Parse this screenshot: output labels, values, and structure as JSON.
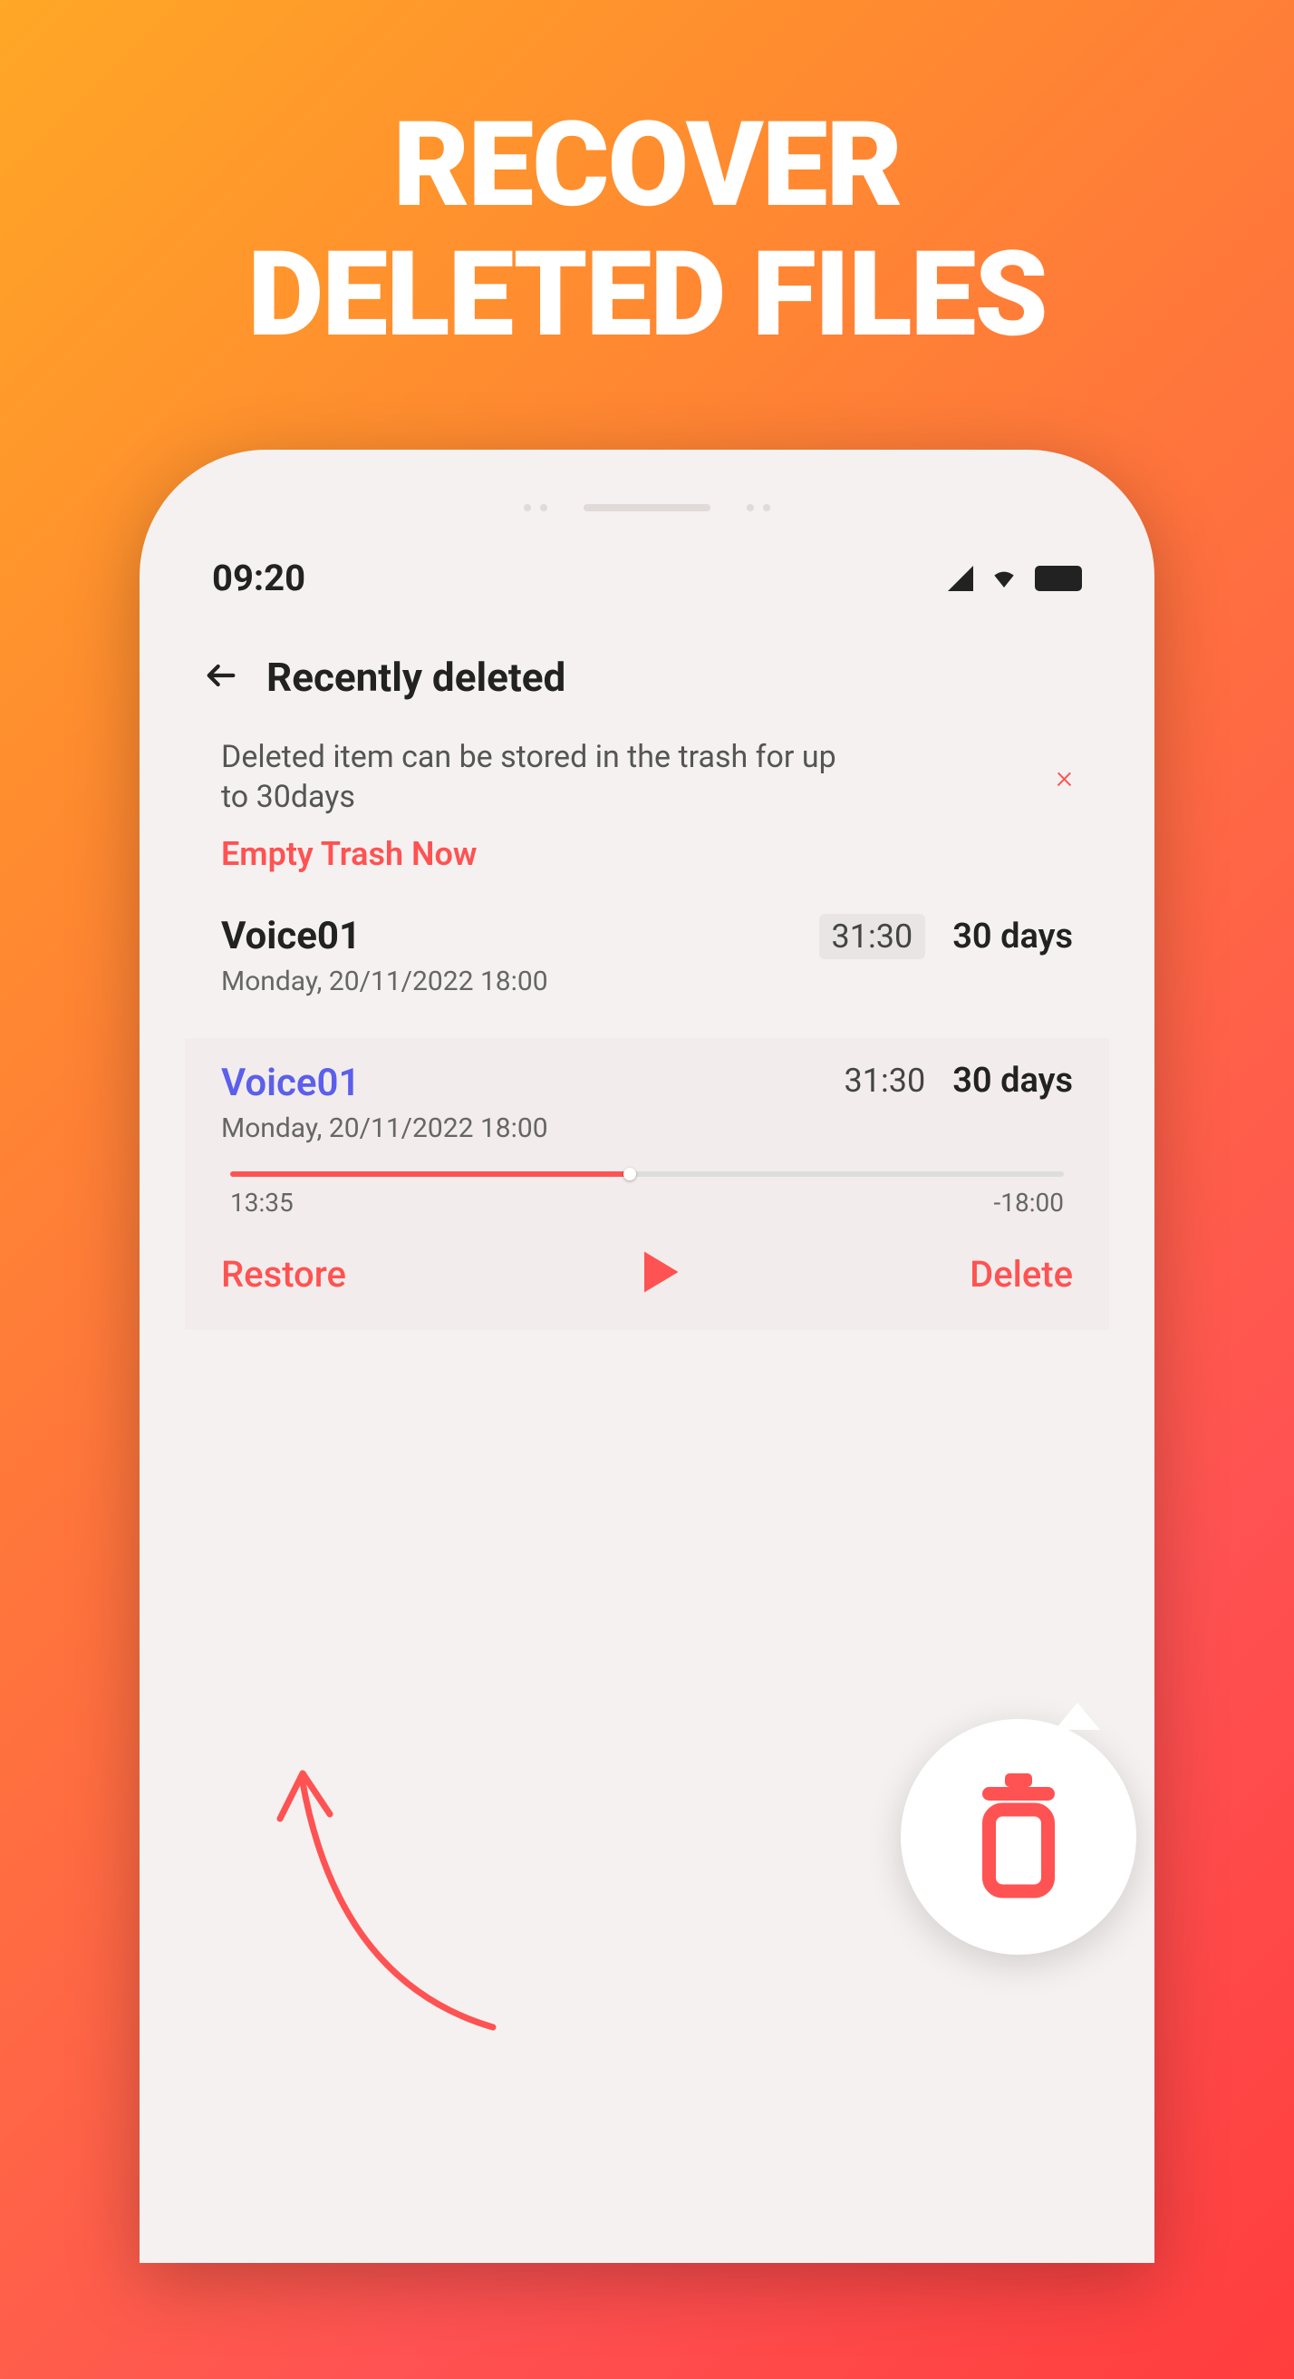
{
  "headline": {
    "line1": "RECOVER",
    "line2": "DELETED FILES"
  },
  "status": {
    "time": "09:20"
  },
  "header": {
    "title": "Recently deleted"
  },
  "notice": {
    "text": "Deleted item can be stored in the trash for up to 30days",
    "close": "×"
  },
  "empty_trash": "Empty Trash Now",
  "items": [
    {
      "title": "Voice01",
      "date": "Monday, 20/11/2022  18:00",
      "duration": "31:30",
      "days": "30 days"
    },
    {
      "title": "Voice01",
      "date": "Monday, 20/11/2022  18:00",
      "duration": "31:30",
      "days": "30 days",
      "progress": {
        "elapsed": "13:35",
        "remaining": "-18:00",
        "percent": 48
      },
      "actions": {
        "restore": "Restore",
        "delete": "Delete"
      }
    }
  ]
}
